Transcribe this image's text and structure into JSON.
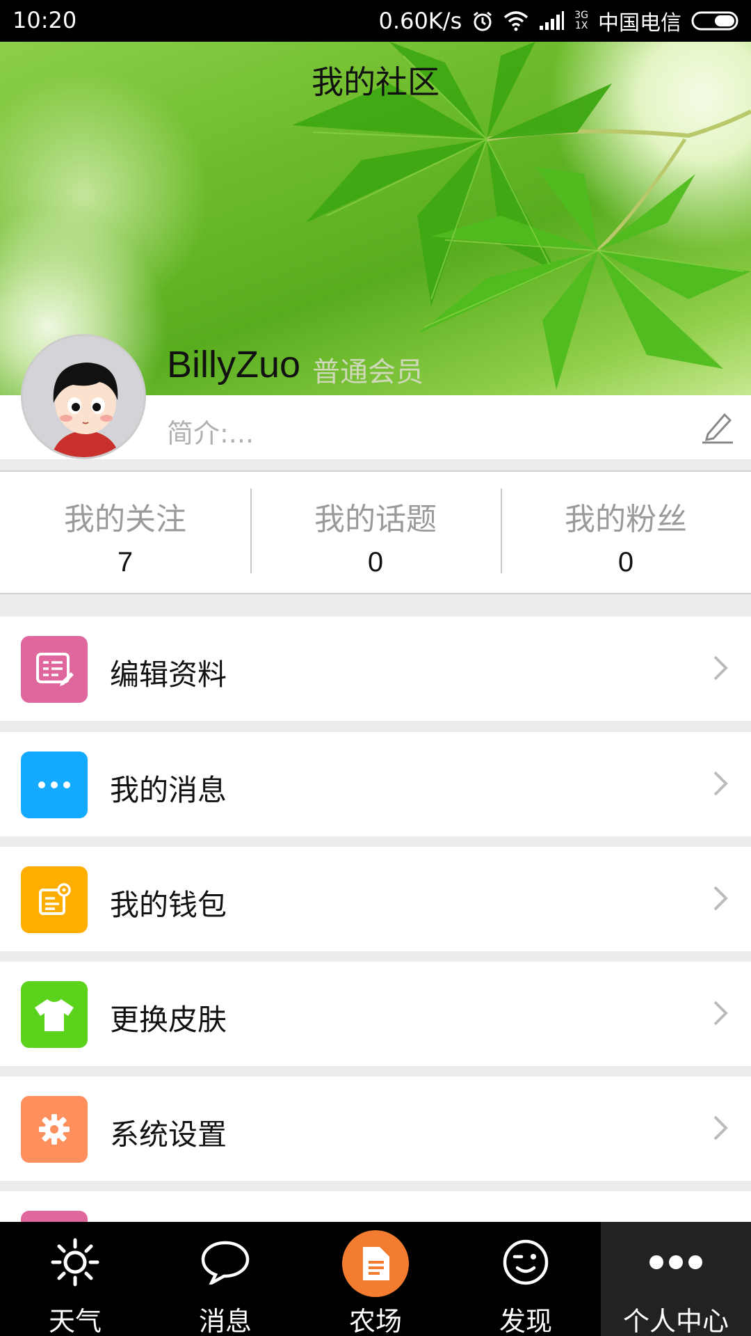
{
  "status_bar": {
    "time": "10:20",
    "net_speed": "0.60K/s",
    "net_type_top": "3G",
    "net_type_bottom": "1X",
    "carrier": "中国电信"
  },
  "header": {
    "title": "我的社区"
  },
  "profile": {
    "username": "BillyZuo",
    "member_level": "普通会员",
    "bio": "简介:..."
  },
  "stats": [
    {
      "label": "我的关注",
      "value": "7"
    },
    {
      "label": "我的话题",
      "value": "0"
    },
    {
      "label": "我的粉丝",
      "value": "0"
    }
  ],
  "menu": {
    "items": [
      {
        "label": "编辑资料",
        "icon": "edit-profile-icon",
        "color": "#e0679d"
      },
      {
        "label": "我的消息",
        "icon": "message-dots-icon",
        "color": "#13aaff"
      },
      {
        "label": "我的钱包",
        "icon": "wallet-icon",
        "color": "#ffae00"
      },
      {
        "label": "更换皮肤",
        "icon": "tshirt-icon",
        "color": "#5bd21c"
      },
      {
        "label": "系统设置",
        "icon": "gear-icon",
        "color": "#ff8f5c"
      }
    ],
    "partial_item_color": "#e0679d"
  },
  "tabbar": {
    "tabs": [
      {
        "label": "天气",
        "icon": "sun-icon"
      },
      {
        "label": "消息",
        "icon": "chat-bubble-icon"
      },
      {
        "label": "农场",
        "icon": "document-icon",
        "accent": "#f47c30"
      },
      {
        "label": "发现",
        "icon": "wink-face-icon"
      },
      {
        "label": "个人中心",
        "icon": "more-dots-icon",
        "active": true
      }
    ]
  }
}
